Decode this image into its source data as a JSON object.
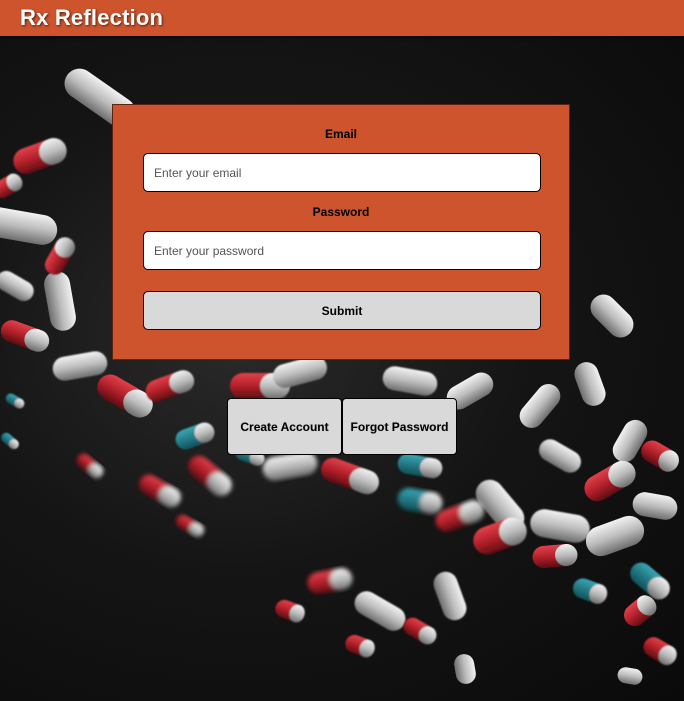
{
  "header": {
    "brand": "Rx Reflection"
  },
  "login": {
    "email_label": "Email",
    "email_placeholder": "Enter your email",
    "email_value": "",
    "password_label": "Password",
    "password_placeholder": "Enter your password",
    "password_value": "",
    "submit_label": "Submit"
  },
  "actions": {
    "create_account_label": "Create Account",
    "forgot_password_label": "Forgot Password"
  },
  "colors": {
    "accent": "#cd542c",
    "button_bg": "#d9d9d9",
    "background": "#111111"
  }
}
